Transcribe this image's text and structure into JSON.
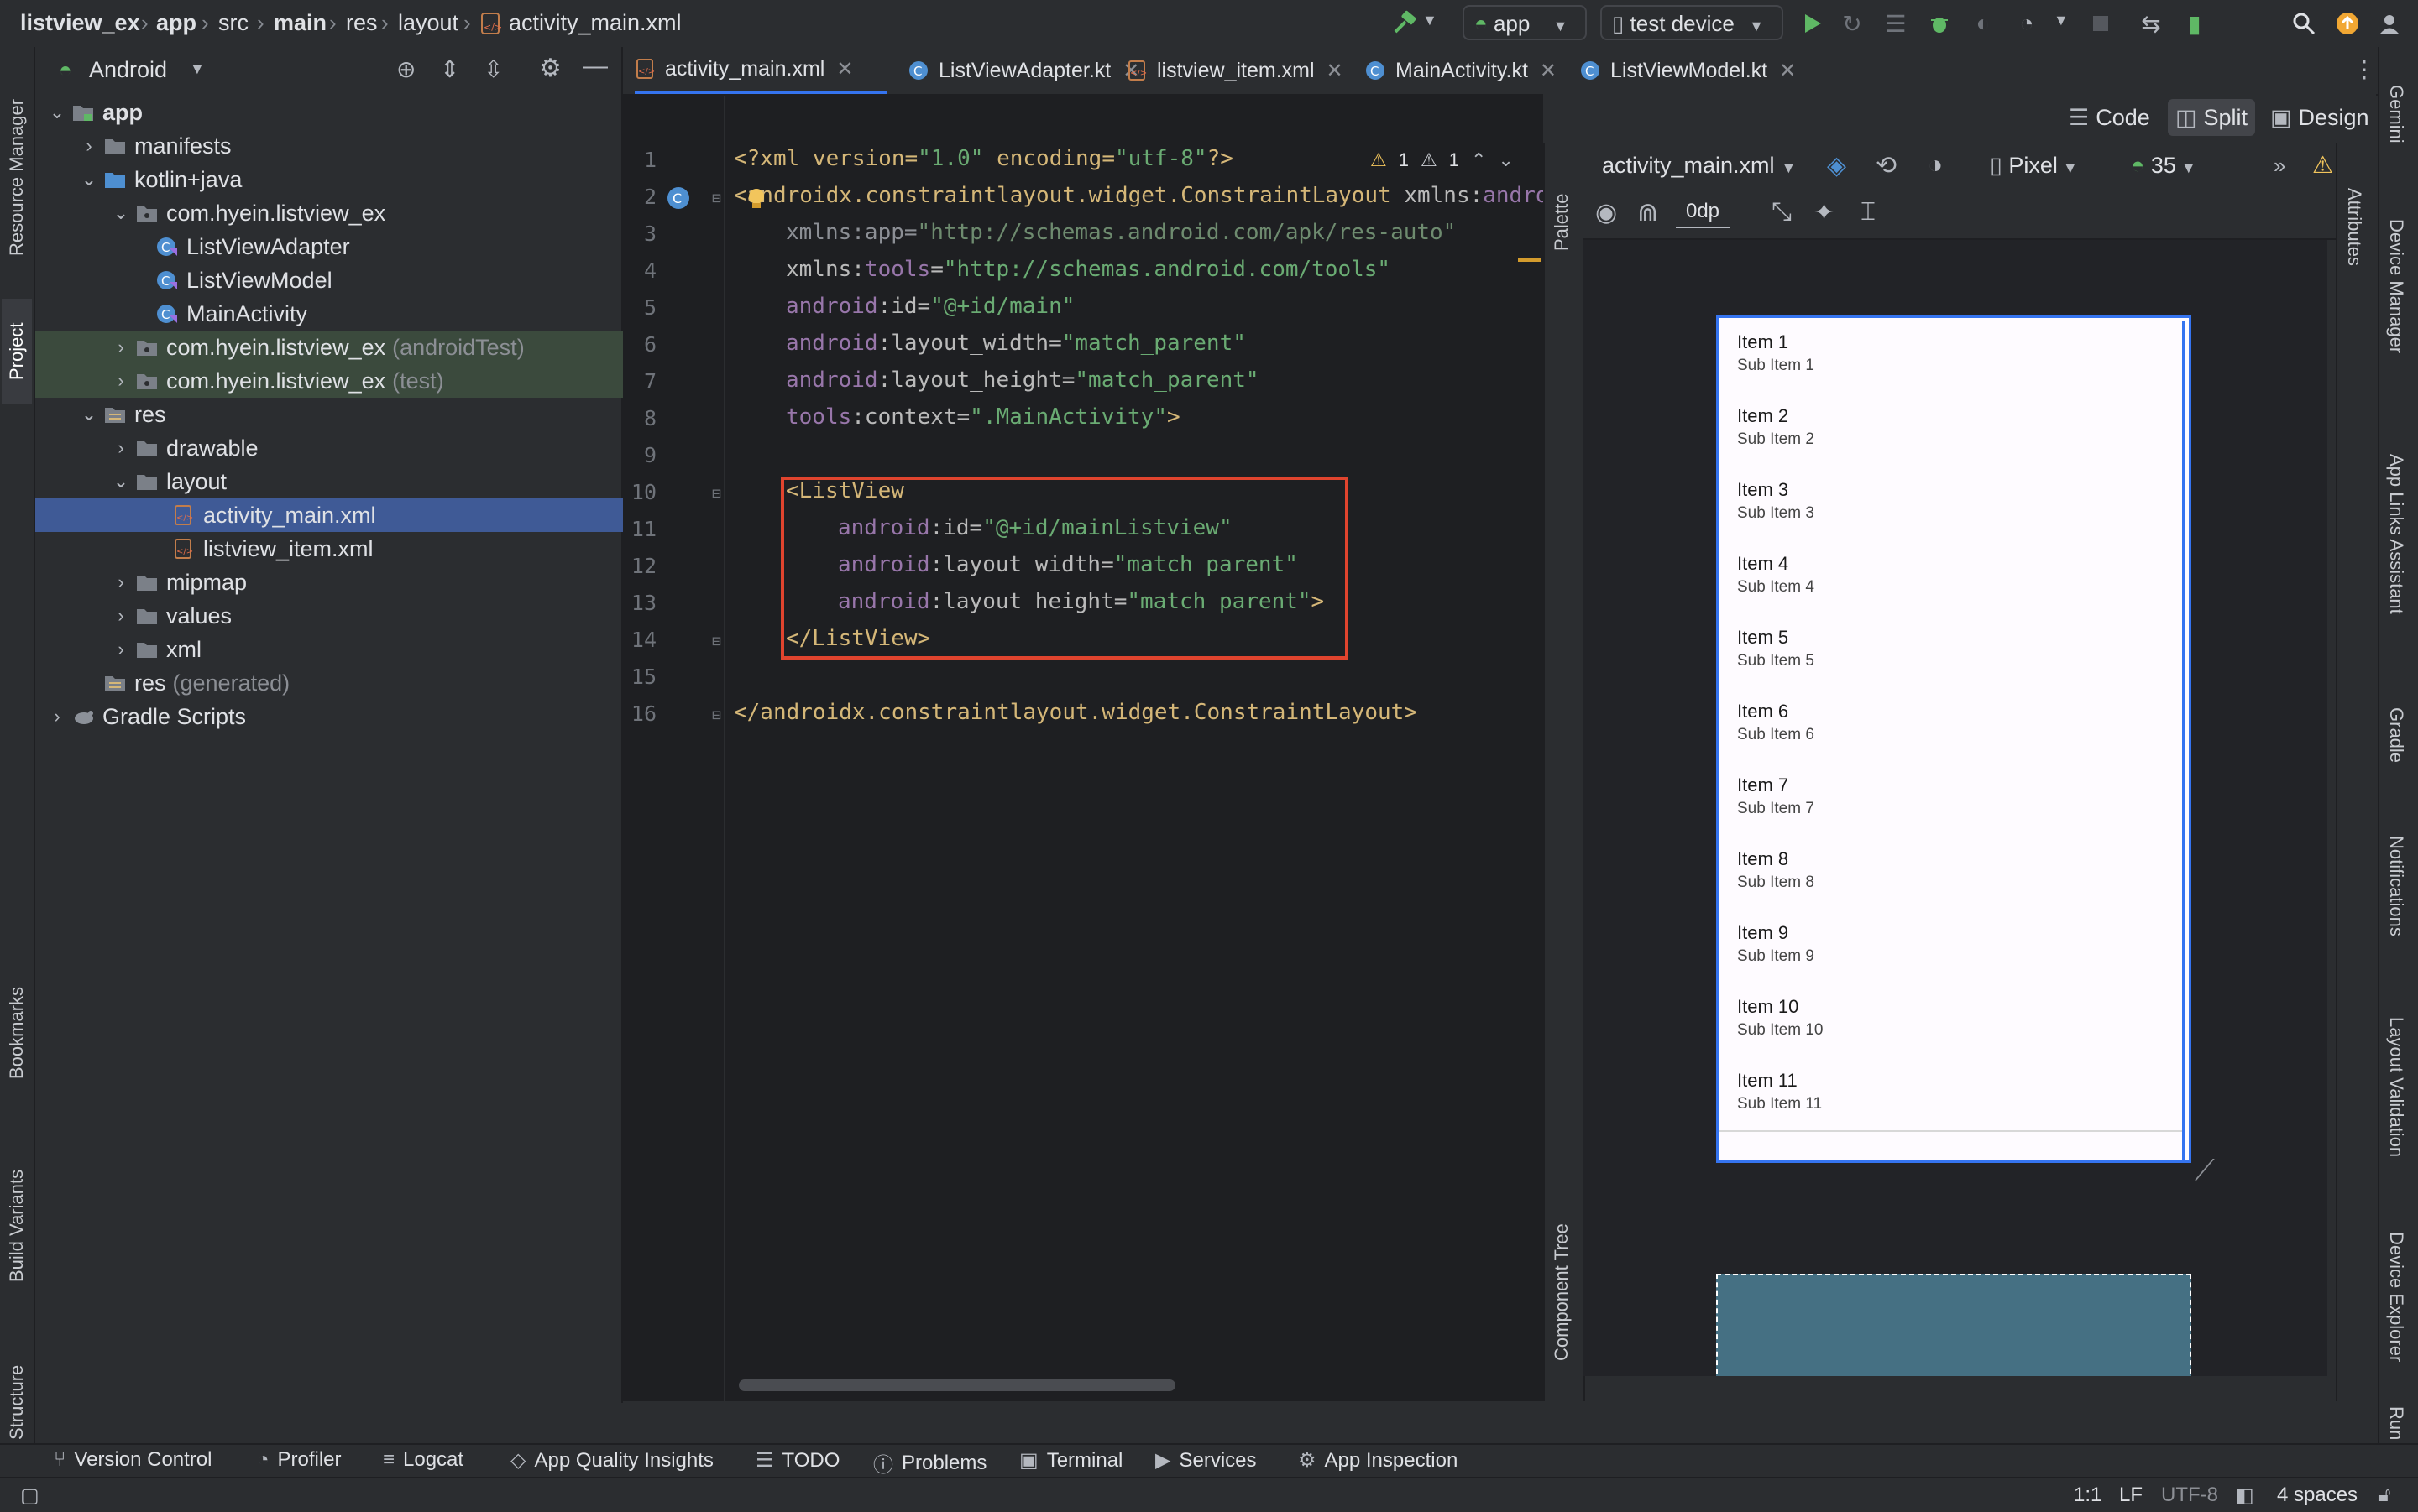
{
  "breadcrumbs": [
    "listview_ex",
    "app",
    "src",
    "main",
    "res",
    "layout",
    "activity_main.xml"
  ],
  "toolbar": {
    "run_config": "app",
    "device": "test device"
  },
  "left_tool_windows": [
    "Resource Manager",
    "Project",
    "Bookmarks",
    "Build Variants",
    "Structure"
  ],
  "right_tool_windows": [
    "Gemini",
    "Device Manager",
    "App Links Assistant",
    "Gradle",
    "Notifications",
    "Layout Validation",
    "Device Explorer",
    "Run"
  ],
  "project_panel": {
    "view_mode": "Android",
    "tree": [
      {
        "label": "app",
        "bold": true
      },
      {
        "label": "manifests"
      },
      {
        "label": "kotlin+java"
      },
      {
        "label": "com.hyein.listview_ex"
      },
      {
        "label": "ListViewAdapter"
      },
      {
        "label": "ListViewModel"
      },
      {
        "label": "MainActivity"
      },
      {
        "label": "com.hyein.listview_ex",
        "suffix": "(androidTest)"
      },
      {
        "label": "com.hyein.listview_ex",
        "suffix": "(test)"
      },
      {
        "label": "res"
      },
      {
        "label": "drawable"
      },
      {
        "label": "layout"
      },
      {
        "label": "activity_main.xml"
      },
      {
        "label": "listview_item.xml"
      },
      {
        "label": "mipmap"
      },
      {
        "label": "values"
      },
      {
        "label": "xml"
      },
      {
        "label": "res",
        "suffix": "(generated)"
      },
      {
        "label": "Gradle Scripts"
      }
    ]
  },
  "editor_tabs": [
    "activity_main.xml",
    "ListViewAdapter.kt",
    "listview_item.xml",
    "MainActivity.kt",
    "ListViewModel.kt"
  ],
  "view_modes": {
    "code": "Code",
    "split": "Split",
    "design": "Design"
  },
  "inspections": {
    "warnings": "1",
    "weak_warnings": "1"
  },
  "code_lines": [
    "1",
    "2",
    "3",
    "4",
    "5",
    "6",
    "7",
    "8",
    "9",
    "10",
    "11",
    "12",
    "13",
    "14",
    "15",
    "16"
  ],
  "code": {
    "l1_a": "<?xml version=",
    "l1_b": "\"1.0\"",
    "l1_c": " encoding=",
    "l1_d": "\"utf-8\"",
    "l1_e": "?>",
    "l2_a": "<",
    "l2_b": "androidx.constraintlayout.widget.ConstraintLayout",
    "l2_c": " xmlns:",
    "l2_d": "andro",
    "l3_a": "xmlns:app=",
    "l3_b": "\"http://schemas.android.com/apk/res-auto\"",
    "l4_a": "xmlns:",
    "l4_b": "tools",
    "l4_c": "=",
    "l4_d": "\"http://schemas.android.com/tools\"",
    "l5_a": "android",
    "l5_b": ":id=",
    "l5_c": "\"@+id/main\"",
    "l6_a": "android",
    "l6_b": ":layout_width=",
    "l6_c": "\"match_parent\"",
    "l7_a": "android",
    "l7_b": ":layout_height=",
    "l7_c": "\"match_parent\"",
    "l8_a": "tools",
    "l8_b": ":context=",
    "l8_c": "\".MainActivity\"",
    "l8_d": ">",
    "l10": "<ListView",
    "l11_a": "android",
    "l11_b": ":id=",
    "l11_c": "\"@+id/mainListview\"",
    "l12_a": "android",
    "l12_b": ":layout_width=",
    "l12_c": "\"match_parent\"",
    "l13_a": "android",
    "l13_b": ":layout_height=",
    "l13_c": "\"match_parent\"",
    "l13_d": ">",
    "l14": "</ListView>",
    "l16": "</androidx.constraintlayout.widget.ConstraintLayout>"
  },
  "design": {
    "palette_label": "Palette",
    "component_tree_label": "Component Tree",
    "file": "activity_main.xml",
    "device": "Pixel",
    "api": "35",
    "margin": "0dp",
    "attributes_label": "Attributes"
  },
  "list_items": [
    {
      "title": "Item 1",
      "sub": "Sub Item 1"
    },
    {
      "title": "Item 2",
      "sub": "Sub Item 2"
    },
    {
      "title": "Item 3",
      "sub": "Sub Item 3"
    },
    {
      "title": "Item 4",
      "sub": "Sub Item 4"
    },
    {
      "title": "Item 5",
      "sub": "Sub Item 5"
    },
    {
      "title": "Item 6",
      "sub": "Sub Item 6"
    },
    {
      "title": "Item 7",
      "sub": "Sub Item 7"
    },
    {
      "title": "Item 8",
      "sub": "Sub Item 8"
    },
    {
      "title": "Item 9",
      "sub": "Sub Item 9"
    },
    {
      "title": "Item 10",
      "sub": "Sub Item 10"
    },
    {
      "title": "Item 11",
      "sub": "Sub Item 11"
    }
  ],
  "bottom_tools": [
    "Version Control",
    "Profiler",
    "Logcat",
    "App Quality Insights",
    "TODO",
    "Problems",
    "Terminal",
    "Services",
    "App Inspection"
  ],
  "status": {
    "position": "1:1",
    "line_sep": "LF",
    "encoding": "UTF-8",
    "indent": "4 spaces"
  },
  "colors": {
    "accent": "#3574f0",
    "highlight_box": "#e0442e",
    "run": "#5fb865",
    "selection": "#2e436e"
  }
}
